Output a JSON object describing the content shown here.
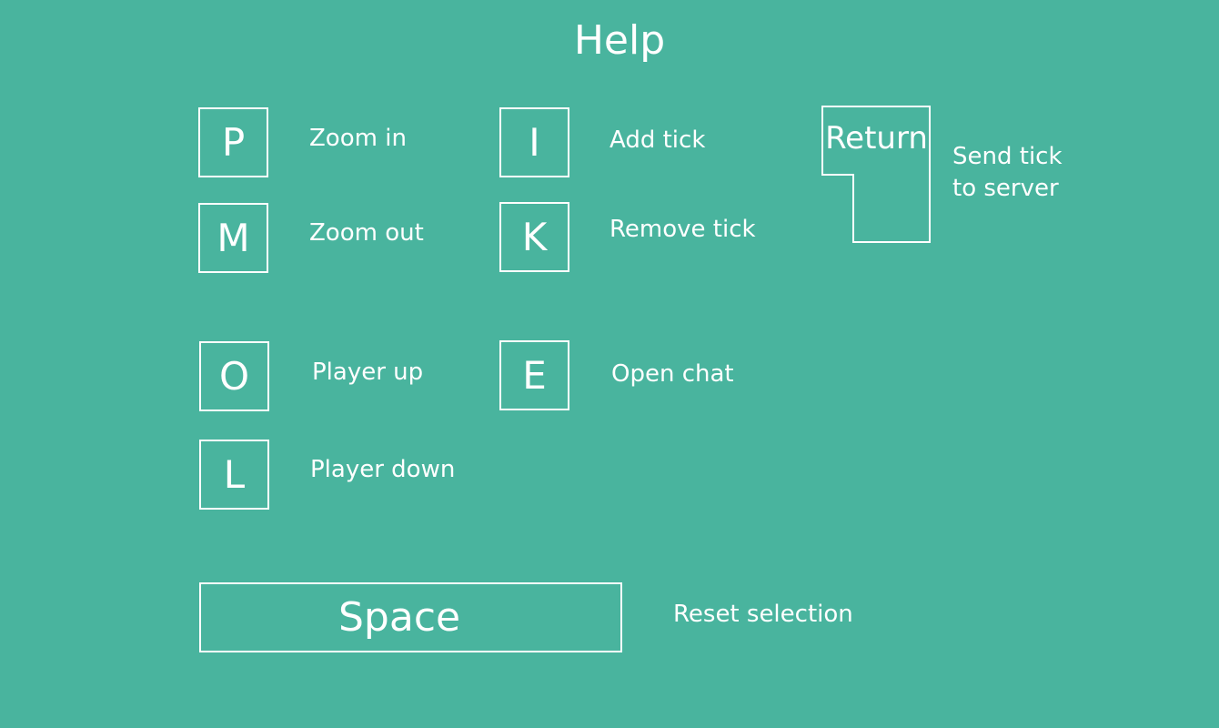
{
  "title": "Help",
  "keys": {
    "p": {
      "key": "P",
      "description": "Zoom in"
    },
    "m": {
      "key": "M",
      "description": "Zoom out"
    },
    "i": {
      "key": "I",
      "description": "Add tick"
    },
    "k": {
      "key": "K",
      "description": "Remove tick"
    },
    "o": {
      "key": "O",
      "description": "Player up"
    },
    "l": {
      "key": "L",
      "description": "Player down"
    },
    "e": {
      "key": "E",
      "description": "Open chat"
    },
    "return": {
      "key": "Return",
      "description_line1": "Send tick",
      "description_line2": "to server"
    },
    "space": {
      "key": "Space",
      "description": "Reset selection"
    }
  },
  "colors": {
    "background": "#49b49e",
    "foreground": "#ffffff"
  }
}
